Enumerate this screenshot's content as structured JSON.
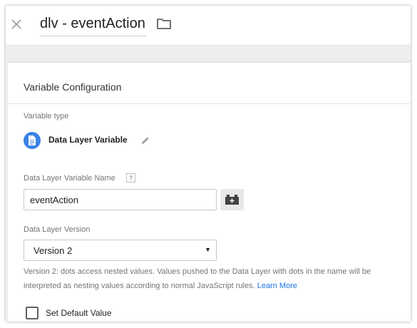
{
  "header": {
    "title": "dlv - eventAction",
    "close_icon": "close-icon",
    "folder_icon": "folder-icon"
  },
  "card": {
    "title": "Variable Configuration",
    "variable_type": {
      "label": "Variable type",
      "value": "Data Layer Variable",
      "icon": "document-icon",
      "icon_color": "#3b82e4"
    },
    "dlv_name": {
      "label": "Data Layer Variable Name",
      "help": "?",
      "value": "eventAction"
    },
    "dlv_version": {
      "label": "Data Layer Version",
      "selected": "Version 2",
      "help_text": "Version 2: dots access nested values. Values pushed to the Data Layer with dots in the name will be interpreted as nesting values according to normal JavaScript rules.",
      "learn_more": "Learn More"
    },
    "default_value": {
      "label": "Set Default Value",
      "checked": false
    }
  },
  "colors": {
    "link": "#1a73e8",
    "band": "#eeeeee"
  }
}
